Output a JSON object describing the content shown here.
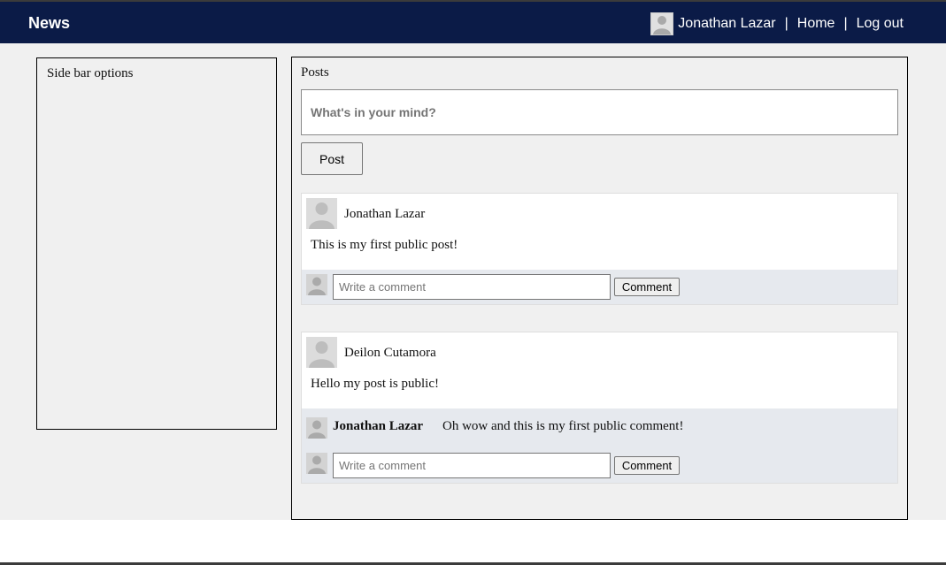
{
  "navbar": {
    "brand": "News",
    "user_name": "Jonathan Lazar",
    "separator": "|",
    "home_label": "Home",
    "logout_label": "Log out",
    "background_color": "#0b1b47"
  },
  "sidebar": {
    "title": "Side bar options"
  },
  "posts": {
    "title": "Posts",
    "composer_placeholder": "What's in your mind?",
    "post_button_label": "Post",
    "comment_placeholder": "Write a comment",
    "comment_button_label": "Comment",
    "items": [
      {
        "author": "Jonathan Lazar",
        "text": "This is my first public post!",
        "comments": []
      },
      {
        "author": "Deilon Cutamora",
        "text": "Hello my post is public!",
        "comments": [
          {
            "author": "Jonathan Lazar",
            "text": "Oh wow and this is my first public comment!"
          }
        ]
      }
    ]
  },
  "icons": {
    "avatar": "user-silhouette-icon"
  }
}
